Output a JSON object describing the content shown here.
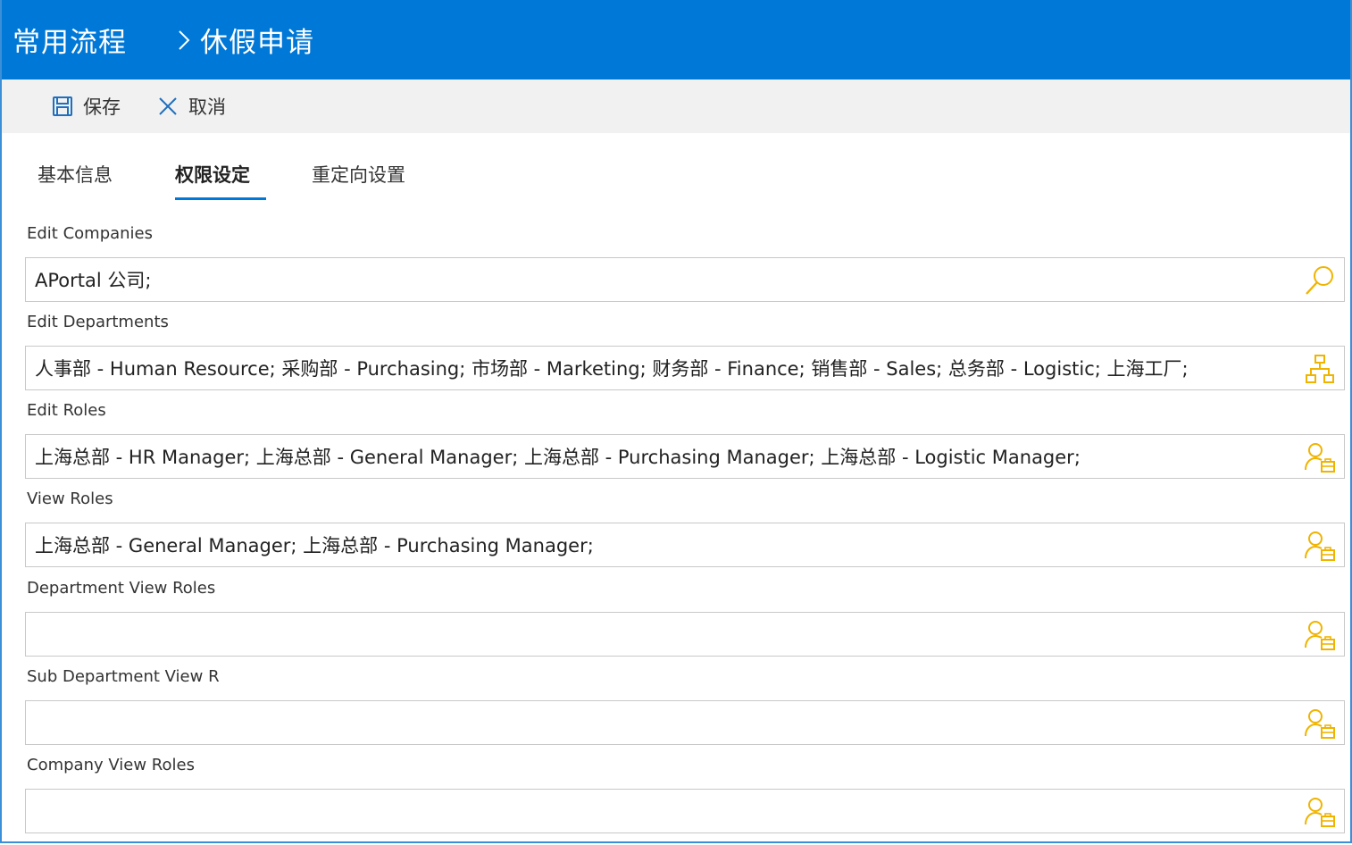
{
  "header": {
    "root": "常用流程",
    "separator_icon": "chevron-right-icon",
    "page": "休假申请"
  },
  "toolbar": {
    "save_label": "保存",
    "save_icon": "floppy-disk-icon",
    "cancel_label": "取消",
    "cancel_icon": "close-icon"
  },
  "tabs": [
    {
      "label": "基本信息",
      "active": false
    },
    {
      "label": "权限设定",
      "active": true
    },
    {
      "label": "重定向设置",
      "active": false
    }
  ],
  "fields": [
    {
      "label": "Edit Companies",
      "value": "APortal 公司;",
      "icon": "search-icon"
    },
    {
      "label": "Edit Departments",
      "value": "人事部 - Human Resource; 采购部 - Purchasing; 市场部 - Marketing; 财务部 - Finance; 销售部 - Sales; 总务部 - Logistic; 上海工厂;",
      "icon": "org-chart-icon"
    },
    {
      "label": "Edit Roles",
      "value": "上海总部 - HR Manager; 上海总部 - General Manager; 上海总部 - Purchasing Manager; 上海总部 - Logistic Manager;",
      "icon": "user-role-icon"
    },
    {
      "label": "View Roles",
      "value": "上海总部 - General Manager; 上海总部 - Purchasing Manager;",
      "icon": "user-role-icon"
    },
    {
      "label": "Department View Roles",
      "value": "",
      "icon": "user-role-icon"
    },
    {
      "label": "Sub Department View R",
      "value": "",
      "icon": "user-role-icon"
    },
    {
      "label": "Company View Roles",
      "value": "",
      "icon": "user-role-icon"
    }
  ],
  "colors": {
    "header_bg": "#0078d7",
    "toolbar_bg": "#f1f1f1",
    "icon_accent": "#f0b400",
    "tab_underline": "#0078d7"
  }
}
